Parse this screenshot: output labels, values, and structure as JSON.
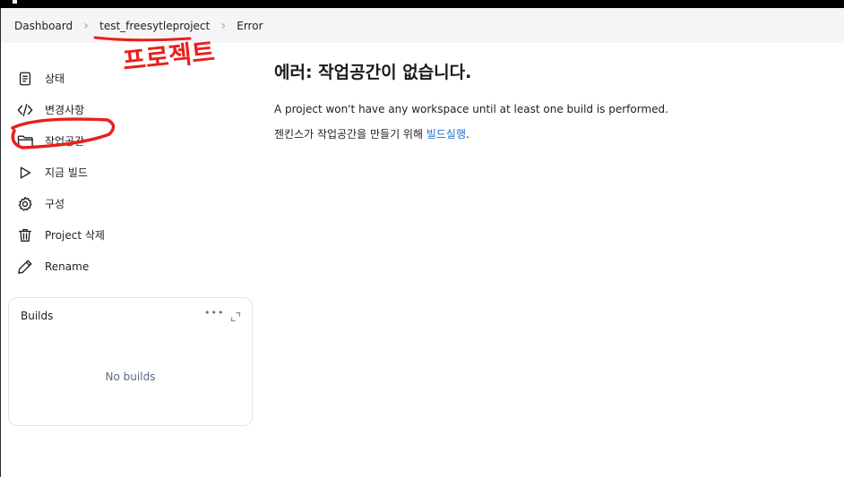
{
  "breadcrumb": {
    "items": [
      "Dashboard",
      "test_freesytleproject",
      "Error"
    ]
  },
  "sidebar": {
    "tasks": [
      {
        "label": "상태",
        "icon": "document-icon"
      },
      {
        "label": "변경사항",
        "icon": "code-icon"
      },
      {
        "label": "작업공간",
        "icon": "folder-icon"
      },
      {
        "label": "지금 빌드",
        "icon": "play-icon"
      },
      {
        "label": "구성",
        "icon": "gear-icon"
      },
      {
        "label": "Project 삭제",
        "icon": "trash-icon"
      },
      {
        "label": "Rename",
        "icon": "pencil-icon"
      }
    ]
  },
  "builds": {
    "title": "Builds",
    "more_label": "•••",
    "empty_text": "No builds"
  },
  "main": {
    "title": "에러: 작업공간이 없습니다.",
    "message": "A project won't have any workspace until at least one build is performed.",
    "action_prefix": "젠킨스가 작업공간을 만들기 위해 ",
    "action_link": "빌드실행",
    "action_suffix": "."
  },
  "annotation": {
    "handwritten_text": "프로젝트",
    "color": "#e8201c"
  },
  "colors": {
    "link": "#1f6fcb",
    "breadcrumb_bg": "#f5f5f7",
    "annotation": "#e8201c"
  }
}
